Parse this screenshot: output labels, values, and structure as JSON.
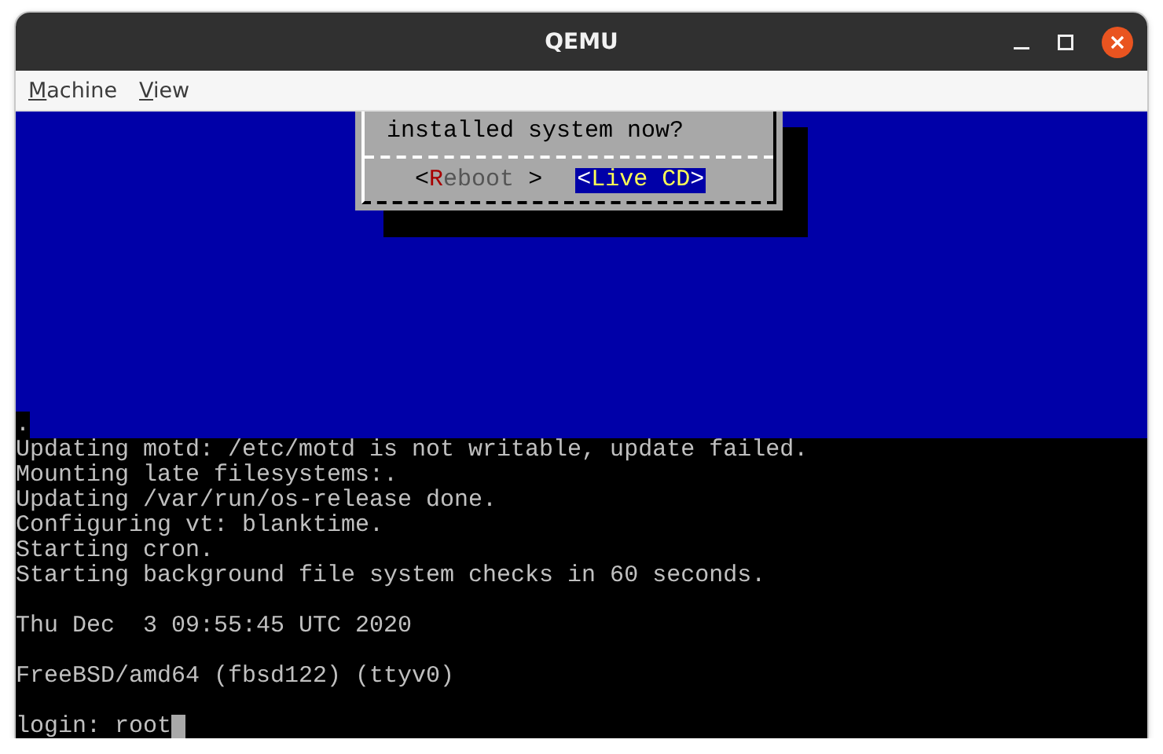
{
  "window": {
    "title": "QEMU"
  },
  "menu": [
    {
      "label": "Machine"
    },
    {
      "label": "View"
    }
  ],
  "dialog": {
    "text": "installed system now?",
    "buttons": [
      {
        "open": "<",
        "label": "Reboot",
        "close": ">",
        "selected": false
      },
      {
        "open": "<",
        "label": "Live CD",
        "close": ">",
        "selected": true
      }
    ]
  },
  "console": {
    "first_line": ".",
    "lines": [
      {
        "kind": "text",
        "text": "Updating motd: /etc/motd is not writable, update failed."
      },
      {
        "kind": "text",
        "text": "Mounting late filesystems:."
      },
      {
        "kind": "text",
        "text": "Updating /var/run/os-release done."
      },
      {
        "kind": "text",
        "text": "Configuring vt: blanktime."
      },
      {
        "kind": "text",
        "text": "Starting cron."
      },
      {
        "kind": "text",
        "text": "Starting background file system checks in 60 seconds."
      },
      {
        "kind": "blank"
      },
      {
        "kind": "text",
        "text": "Thu Dec  3 09:55:45 UTC 2020"
      },
      {
        "kind": "blank"
      },
      {
        "kind": "text",
        "text": "FreeBSD/amd64 (fbsd122) (ttyv0)"
      },
      {
        "kind": "blank"
      },
      {
        "kind": "text",
        "text": "login: root"
      }
    ],
    "cursor": true
  }
}
